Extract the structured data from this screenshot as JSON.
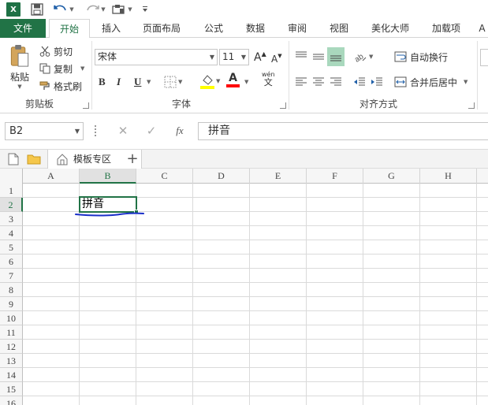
{
  "qat": {
    "logo_text": "X",
    "icons": [
      "excel-logo-icon",
      "save-icon",
      "undo-icon",
      "redo-icon",
      "view-icon",
      "customize-icon"
    ]
  },
  "tabs": [
    {
      "label": "文件"
    },
    {
      "label": "开始"
    },
    {
      "label": "插入"
    },
    {
      "label": "页面布局"
    },
    {
      "label": "公式"
    },
    {
      "label": "数据"
    },
    {
      "label": "审阅"
    },
    {
      "label": "视图"
    },
    {
      "label": "美化大师"
    },
    {
      "label": "加载项"
    },
    {
      "label": "A"
    }
  ],
  "clipboard": {
    "paste": "粘贴",
    "cut": "剪切",
    "copy": "复制",
    "format_painter": "格式刷",
    "group_label": "剪贴板"
  },
  "font": {
    "name": "宋体",
    "size": "11",
    "grow": "A",
    "shrink": "A",
    "bold": "B",
    "italic": "I",
    "underline": "U",
    "font_color": "A",
    "phonetic": "wén",
    "phonetic_sub": "文",
    "group_label": "字体"
  },
  "alignment": {
    "wrap_text": "自动换行",
    "merge_center": "合并后居中",
    "group_label": "对齐方式"
  },
  "formula_bar": {
    "name_box": "B2",
    "fx": "fx",
    "content": "拼音"
  },
  "tab_strip": {
    "doc_tab": "模板专区",
    "add": "+"
  },
  "grid": {
    "columns": [
      "A",
      "B",
      "C",
      "D",
      "E",
      "F",
      "G",
      "H"
    ],
    "rows": [
      "1",
      "2",
      "3",
      "4",
      "5",
      "6",
      "7",
      "8",
      "9",
      "10",
      "11",
      "12",
      "13",
      "14",
      "15",
      "16"
    ],
    "selected_column": "B",
    "selected_row": "2",
    "active_cell_value": "拼音"
  },
  "colors": {
    "accent": "#217346",
    "highlight_yellow": "#ffff00",
    "font_red": "#ff0000",
    "annotation_blue": "#1a2fc9"
  }
}
